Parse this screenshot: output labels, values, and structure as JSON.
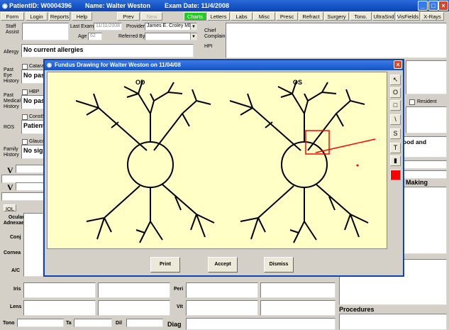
{
  "window": {
    "patient_id": "PatientID: W0004396",
    "name": "Name:  Walter Weston",
    "exam_date": "Exam Date: 11/4/2008"
  },
  "toolbar": {
    "form": "Form",
    "login": "Login",
    "reports": "Reports",
    "help": "Help",
    "prev": "Prev",
    "new": "New",
    "tabs": [
      "Charts",
      "Letters",
      "Labs",
      "Misc",
      "Presc",
      "Refract",
      "Surgery",
      "Tono.",
      "UltraSnd",
      "VisFields",
      "X-Rays"
    ]
  },
  "header": {
    "staff_assist": "Staff\nAssist",
    "last_exam_label": "Last Exam",
    "last_exam_value": "11/11/2008",
    "age_label": "Age",
    "age_value": "62",
    "provider_label": "Provider",
    "provider_value": "James E. Croley MD",
    "referred_label": "Referred By",
    "referred_value": "",
    "chief_complaint": "Chief\nComplaint",
    "hpi": "HPI"
  },
  "left": {
    "allergy_label": "Allergy",
    "allergy_value": "No current allergies",
    "past_eye_label": "Past\nEye\nHistory",
    "past_eye_value": "No pas",
    "cataract_label": "Catarac",
    "past_medical_label": "Past\nMedical\nHistory",
    "past_medical_value": "No pas",
    "hbp_label": "HBP",
    "ros_label": "ROS",
    "ros_value": "Patient",
    "const_label": "ConstS",
    "family_label": "Family\nHistory",
    "family_value": "No sig",
    "glauc_label": "Glauco",
    "v1": "V",
    "v2": "V",
    "iol": "IOL",
    "exam_labels": [
      "Ocular\nAdnexae",
      "Conj",
      "Cornea",
      "A/C",
      "Iris",
      "Lens"
    ],
    "peri": "Peri",
    "vit": "Vit",
    "diag": "Diag",
    "tono": "Tono",
    "ta": "Ta",
    "dil": "Dil"
  },
  "right": {
    "resident_label": "Resident",
    "text_fragment": "ood and",
    "making": "Making",
    "procedures": "Procedures"
  },
  "modal": {
    "title": "Fundus Drawing for Walter Weston on 11/04/08",
    "od": "OD",
    "os": "OS",
    "print": "Print",
    "accept": "Accept",
    "dismiss": "Dismiss",
    "tools": [
      "arrow-icon",
      "circle-icon",
      "square-icon",
      "line-icon",
      "freehand-icon",
      "text-icon",
      "trash-icon",
      "color-swatch"
    ],
    "tool_glyphs": [
      "↖",
      "O",
      "□",
      "\\",
      "S",
      "T",
      "▮",
      ""
    ],
    "draw_color": "#ff0000"
  }
}
